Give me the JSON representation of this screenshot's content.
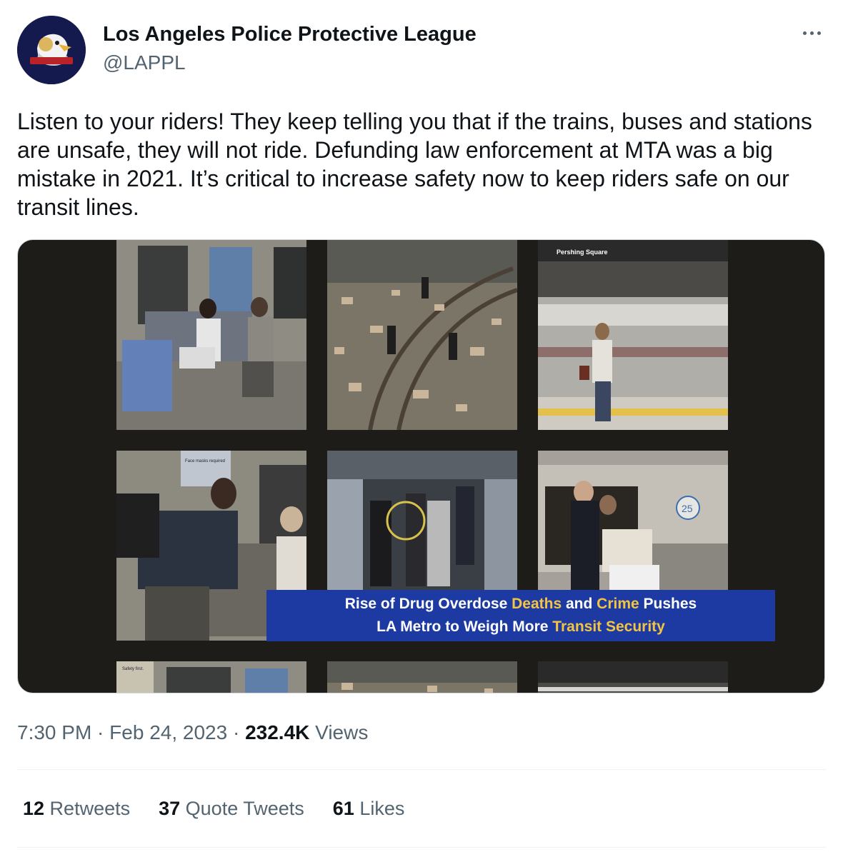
{
  "author": {
    "display_name": "Los Angeles Police Protective League",
    "handle": "@LAPPL"
  },
  "tweet": {
    "text": "Listen to your riders! They keep telling you that if the trains, buses and stations are unsafe, they will not ride. Defunding law enforcement at MTA was a big mistake in 2021. It’s critical to increase safety now to keep riders safe on our transit lines."
  },
  "media": {
    "station_sign": "Pershing Square",
    "mask_sign": "Face masks required",
    "safety_sign": "Safety first.",
    "car_number": "25",
    "banner": {
      "line1_a": "Rise of Drug Overdose ",
      "line1_b": "Deaths",
      "line1_c": " and ",
      "line1_d": "Crime",
      "line1_e": " Pushes",
      "line2_a": "LA Metro to Weigh More ",
      "line2_b": "Transit Security"
    }
  },
  "meta": {
    "time": "7:30 PM",
    "sep1": " · ",
    "date": "Feb 24, 2023",
    "sep2": " · ",
    "views_count": "232.4K",
    "views_label": " Views"
  },
  "stats": [
    {
      "count": "12",
      "label": " Retweets"
    },
    {
      "count": "37",
      "label": " Quote Tweets"
    },
    {
      "count": "61",
      "label": " Likes"
    }
  ],
  "colors": {
    "banner_bg": "#1c3aa2",
    "highlight": "#f3c442",
    "secondary_text": "#536471",
    "avatar_bg": "#141a4e"
  }
}
